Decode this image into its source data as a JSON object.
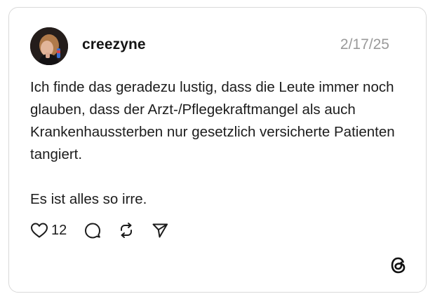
{
  "post": {
    "username": "creezyne",
    "date": "2/17/25",
    "paragraphs": [
      "Ich finde das geradezu lustig, dass die Leute immer noch glauben, dass der Arzt-/Pflegekraftmangel als auch Krankenhaussterben nur gesetzlich versicherte Patienten tangiert.",
      "Es ist alles so irre."
    ],
    "like_count": "12"
  },
  "icons": {
    "like": "heart-icon",
    "comment": "comment-bubble-icon",
    "repost": "repost-icon",
    "share": "send-icon",
    "brand": "threads-logo-icon"
  }
}
